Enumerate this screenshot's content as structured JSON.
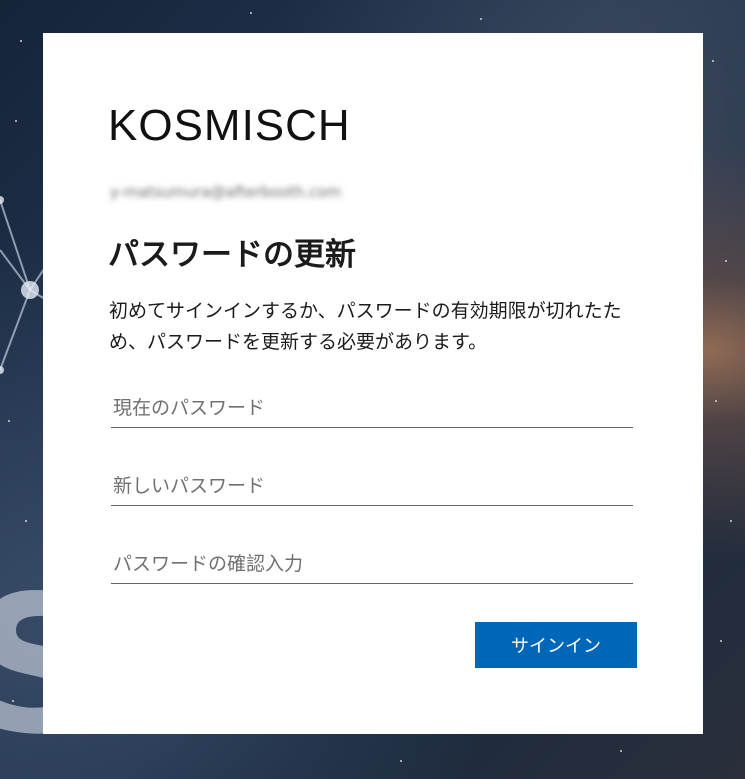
{
  "brand": {
    "logo_text": "KOSMISCH"
  },
  "account": {
    "email": "y-matsumura@afterbooth.com"
  },
  "form": {
    "title": "パスワードの更新",
    "description": "初めてサインインするか、パスワードの有効期限が切れたため、パスワードを更新する必要があります。",
    "current_password_placeholder": "現在のパスワード",
    "new_password_placeholder": "新しいパスワード",
    "confirm_password_placeholder": "パスワードの確認入力",
    "signin_label": "サインイン"
  },
  "colors": {
    "primary_button": "#0067b8",
    "card_background": "#ffffff"
  }
}
